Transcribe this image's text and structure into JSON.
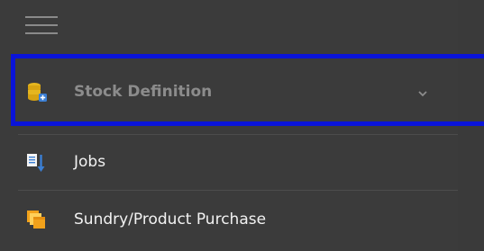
{
  "sidebar": {
    "menu_button_icon": "hamburger-icon",
    "items": [
      {
        "label": "Stock Definition",
        "icon": "database-add-icon",
        "state": "highlighted",
        "expand_icon": "chevron-down-icon"
      },
      {
        "label": "Jobs",
        "icon": "jobs-list-icon"
      },
      {
        "label": "Sundry/Product Purchase",
        "icon": "purchase-stack-icon"
      }
    ]
  },
  "colors": {
    "sidebar_bg": "#3b3b3b",
    "highlight_border": "#0a14d9",
    "active_label": "#8c8c8c",
    "normal_label": "#f2f2f2",
    "icon_gold": "#e5b61f",
    "icon_blue": "#3b7fd4",
    "icon_orange": "#f2a21b"
  }
}
